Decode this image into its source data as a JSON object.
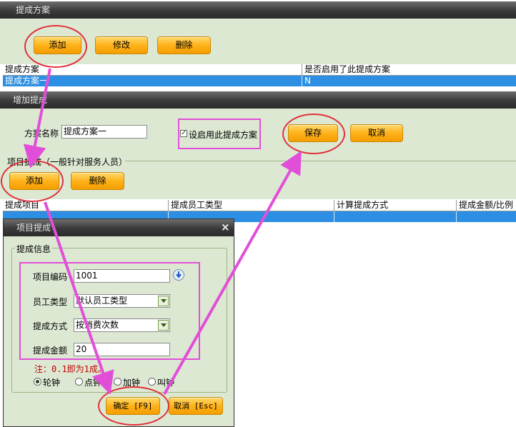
{
  "scheme_window": {
    "title": "提成方案",
    "add_label": "添加",
    "edit_label": "修改",
    "delete_label": "删除",
    "columns": [
      "提成方案",
      "是否启用了此提成方案"
    ],
    "rows": [
      [
        "提成方案一",
        "N"
      ]
    ]
  },
  "add_window": {
    "title": "增加提成",
    "name_label": "方案名称",
    "name_value": "提成方案一",
    "enable_label": "设启用此提成方案",
    "enable_checked": true,
    "save_label": "保存",
    "cancel_label": "取消",
    "section_label": "项目提成（一般针对服务人员）",
    "add_label": "添加",
    "delete_label": "删除",
    "columns": [
      "提成项目",
      "提成员工类型",
      "计算提成方式",
      "提成金额/比例"
    ]
  },
  "dialog": {
    "title": "项目提成",
    "close": "×",
    "group_label": "提成信息",
    "code_label": "项目编码",
    "code_value": "1001",
    "emp_type_label": "员工类型",
    "emp_type_value": "默认员工类型",
    "method_label": "提成方式",
    "method_value": "按消费次数",
    "amount_label": "提成金额",
    "amount_value": "20",
    "note": "注：0.1即为1成。",
    "radios": [
      "轮钟",
      "点钟",
      "加钟",
      "叫钟"
    ],
    "radio_selected": 0,
    "ok_label": "确定 [F9]",
    "cancel_label": "取消 [Esc]"
  },
  "colors": {
    "accent_orange": "#ffb21a",
    "panel_green": "#dde8d3",
    "selection_blue": "#2c8fe3",
    "annotation_pink": "#e14fd8",
    "annotation_red": "#e0313b",
    "note_red": "#c00000"
  }
}
